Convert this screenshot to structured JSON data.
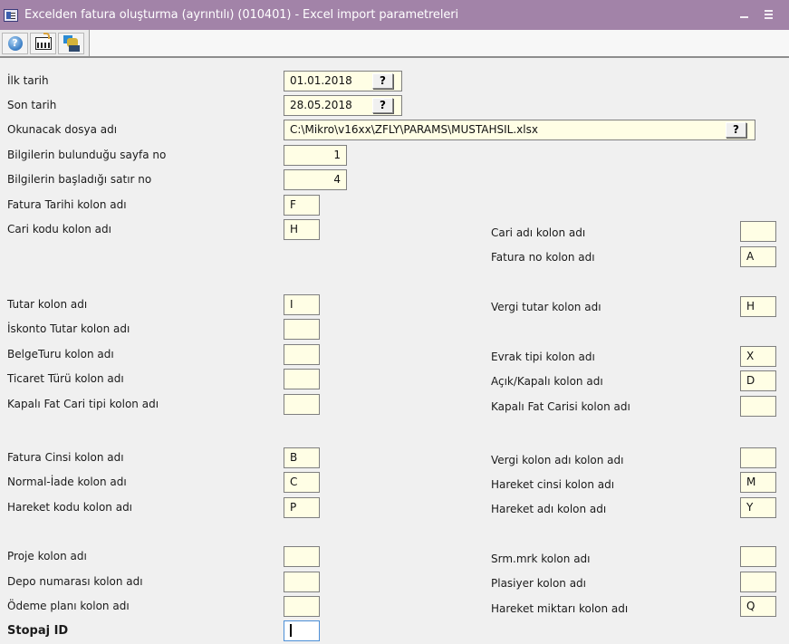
{
  "window": {
    "title": "Excelden fatura oluşturma (ayrıntılı) (010401) - Excel import parametreleri",
    "title_bar_color": "#a283a8",
    "minimize_label": "minimize",
    "close_label": "menu"
  },
  "toolbar": {
    "buttons": [
      {
        "name": "help",
        "icon": "help-icon",
        "glyph": "?"
      },
      {
        "name": "calculator",
        "icon": "calculator-icon"
      },
      {
        "name": "excel-import",
        "icon": "excel-import-icon"
      }
    ]
  },
  "form": {
    "ilk_tarih": {
      "label": "İlk tarih",
      "value": "01.01.2018",
      "button": "?"
    },
    "son_tarih": {
      "label": "Son tarih",
      "value": "28.05.2018",
      "button": "?"
    },
    "dosya_adi": {
      "label": "Okunacak dosya adı",
      "value": "C:\\Mikro\\v16xx\\ZFLY\\PARAMS\\MUSTAHSIL.xlsx",
      "button": "?"
    },
    "sayfa_no": {
      "label": "Bilgilerin bulunduğu sayfa no",
      "value": "1"
    },
    "satir_no": {
      "label": "Bilgilerin başladığı satır no",
      "value": "4"
    },
    "left_fields": [
      {
        "label": "Fatura Tarihi kolon adı",
        "value": "F"
      },
      {
        "label": "Cari kodu kolon adı",
        "value": "H"
      },
      {
        "label": "Tutar kolon adı",
        "value": "I"
      },
      {
        "label": "İskonto Tutar kolon adı",
        "value": ""
      },
      {
        "label": "BelgeTuru kolon adı",
        "value": ""
      },
      {
        "label": "Ticaret Türü kolon adı",
        "value": ""
      },
      {
        "label": "Kapalı Fat Cari tipi kolon adı",
        "value": ""
      },
      {
        "label": "Fatura Cinsi kolon adı",
        "value": "B"
      },
      {
        "label": "Normal-İade kolon adı",
        "value": "C"
      },
      {
        "label": "Hareket kodu kolon adı",
        "value": "P"
      },
      {
        "label": "Proje kolon adı",
        "value": ""
      },
      {
        "label": "Depo numarası kolon adı",
        "value": ""
      },
      {
        "label": "Ödeme planı kolon adı",
        "value": ""
      },
      {
        "label": "Stopaj ID",
        "value": ""
      }
    ],
    "right_fields": [
      {
        "label": "Cari adı kolon adı",
        "value": ""
      },
      {
        "label": "Fatura no kolon adı",
        "value": "A"
      },
      {
        "label": "Vergi tutar kolon adı",
        "value": "H"
      },
      {
        "label": "Evrak tipi kolon adı",
        "value": "X"
      },
      {
        "label": "Açık/Kapalı kolon adı",
        "value": "D"
      },
      {
        "label": "Kapalı Fat Carisi kolon adı",
        "value": ""
      },
      {
        "label": "Vergi kolon adı kolon adı",
        "value": ""
      },
      {
        "label": "Hareket cinsi kolon adı",
        "value": "M"
      },
      {
        "label": "Hareket adı kolon adı",
        "value": "Y"
      },
      {
        "label": "Srm.mrk kolon adı",
        "value": ""
      },
      {
        "label": "Plasiyer kolon adı",
        "value": ""
      },
      {
        "label": "Hareket miktarı kolon adı",
        "value": "Q"
      }
    ]
  }
}
